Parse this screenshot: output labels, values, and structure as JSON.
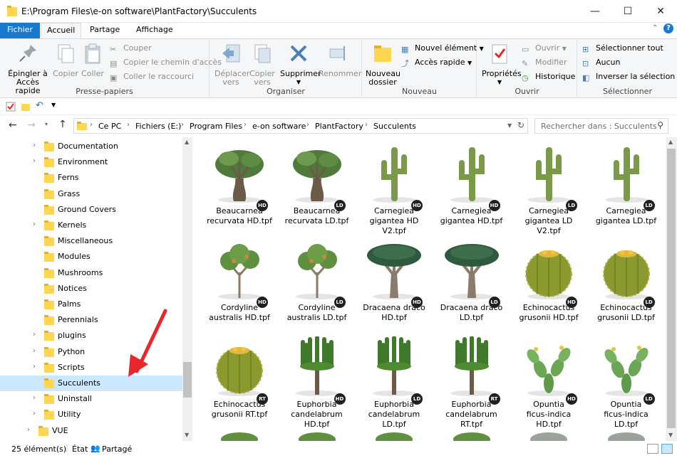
{
  "window": {
    "title": "E:\\Program Files\\e-on software\\PlantFactory\\Succulents",
    "minimize": "—",
    "maximize": "☐",
    "close": "✕"
  },
  "ribbon_tabs": [
    "Fichier",
    "Accueil",
    "Partage",
    "Affichage"
  ],
  "ribbon": {
    "clipboard": {
      "label": "Presse-papiers",
      "pin": "Épingler à\nAccès rapide",
      "pin_1": "Épingler à",
      "pin_2": "Accès rapide",
      "copy": "Copier",
      "paste": "Coller",
      "cut": "Couper",
      "copy_path": "Copier le chemin d'accès",
      "paste_shortcut": "Coller le raccourci"
    },
    "organize": {
      "label": "Organiser",
      "move_1": "Déplacer",
      "move_2": "vers",
      "copy_1": "Copier",
      "copy_2": "vers",
      "delete": "Supprimer",
      "rename": "Renommer"
    },
    "new": {
      "label": "Nouveau",
      "new_folder_1": "Nouveau",
      "new_folder_2": "dossier",
      "new_item": "Nouvel élément",
      "easy_access": "Accès rapide"
    },
    "open": {
      "label": "Ouvrir",
      "properties": "Propriétés",
      "open": "Ouvrir",
      "edit": "Modifier",
      "history": "Historique"
    },
    "select": {
      "label": "Sélectionner",
      "select_all": "Sélectionner tout",
      "none": "Aucun",
      "invert": "Inverser la sélection"
    }
  },
  "address": {
    "crumbs": [
      "Ce PC",
      "Fichiers (E:)",
      "Program Files",
      "e-on software",
      "PlantFactory",
      "Succulents"
    ],
    "search_placeholder": "Rechercher dans : Succulents"
  },
  "nav_tree": [
    {
      "label": "Documentation",
      "expandable": true
    },
    {
      "label": "Environment",
      "expandable": true
    },
    {
      "label": "Ferns",
      "expandable": false
    },
    {
      "label": "Grass",
      "expandable": false
    },
    {
      "label": "Ground Covers",
      "expandable": false
    },
    {
      "label": "Kernels",
      "expandable": true
    },
    {
      "label": "Miscellaneous",
      "expandable": false
    },
    {
      "label": "Modules",
      "expandable": false
    },
    {
      "label": "Mushrooms",
      "expandable": false
    },
    {
      "label": "Notices",
      "expandable": false
    },
    {
      "label": "Palms",
      "expandable": false
    },
    {
      "label": "Perennials",
      "expandable": false
    },
    {
      "label": "plugins",
      "expandable": true
    },
    {
      "label": "Python",
      "expandable": true
    },
    {
      "label": "Scripts",
      "expandable": true
    },
    {
      "label": "Succulents",
      "expandable": false,
      "selected": true
    },
    {
      "label": "Uninstall",
      "expandable": true
    },
    {
      "label": "Utility",
      "expandable": true
    },
    {
      "label": "VUE",
      "expandable": true
    }
  ],
  "files": [
    {
      "name": "Beaucarnea recurvata HD.tpf",
      "line1": "Beaucarnea",
      "line2": "recurvata HD.tpf",
      "line3": "",
      "badge": "HD",
      "plant": "beaucarnea"
    },
    {
      "name": "Beaucarnea recurvata LD.tpf",
      "line1": "Beaucarnea",
      "line2": "recurvata LD.tpf",
      "line3": "",
      "badge": "LD",
      "plant": "beaucarnea"
    },
    {
      "name": "Carnegiea gigantea HD V2.tpf",
      "line1": "Carnegiea",
      "line2": "gigantea HD",
      "line3": "V2.tpf",
      "badge": "HD",
      "plant": "cactus"
    },
    {
      "name": "Carnegiea gigantea HD.tpf",
      "line1": "Carnegiea",
      "line2": "gigantea HD.tpf",
      "line3": "",
      "badge": "HD",
      "plant": "cactus"
    },
    {
      "name": "Carnegiea gigantea LD V2.tpf",
      "line1": "Carnegiea",
      "line2": "gigantea LD",
      "line3": "V2.tpf",
      "badge": "LD",
      "plant": "cactus"
    },
    {
      "name": "Carnegiea gigantea LD.tpf",
      "line1": "Carnegiea",
      "line2": "gigantea LD.tpf",
      "line3": "",
      "badge": "LD",
      "plant": "cactus"
    },
    {
      "name": "Cordyline australis HD.tpf",
      "line1": "Cordyline",
      "line2": "australis HD.tpf",
      "line3": "",
      "badge": "HD",
      "plant": "cordyline"
    },
    {
      "name": "Cordyline australis LD.tpf",
      "line1": "Cordyline",
      "line2": "australis LD.tpf",
      "line3": "",
      "badge": "LD",
      "plant": "cordyline"
    },
    {
      "name": "Dracaena draco HD.tpf",
      "line1": "Dracaena draco",
      "line2": "HD.tpf",
      "line3": "",
      "badge": "HD",
      "plant": "dracaena"
    },
    {
      "name": "Dracaena draco LD.tpf",
      "line1": "Dracaena draco",
      "line2": "LD.tpf",
      "line3": "",
      "badge": "LD",
      "plant": "dracaena"
    },
    {
      "name": "Echinocactus grusonii HD.tpf",
      "line1": "Echinocactus",
      "line2": "grusonii HD.tpf",
      "line3": "",
      "badge": "HD",
      "plant": "barrel"
    },
    {
      "name": "Echinocactus grusonii LD.tpf",
      "line1": "Echinocactus",
      "line2": "grusonii LD.tpf",
      "line3": "",
      "badge": "LD",
      "plant": "barrel"
    },
    {
      "name": "Echinocactus grusonii RT.tpf",
      "line1": "Echinocactus",
      "line2": "grusonii RT.tpf",
      "line3": "",
      "badge": "RT",
      "plant": "barrel"
    },
    {
      "name": "Euphorbia candelabrum HD.tpf",
      "line1": "Euphorbia",
      "line2": "candelabrum",
      "line3": "HD.tpf",
      "badge": "HD",
      "plant": "euphorbia"
    },
    {
      "name": "Euphorbia candelabrum LD.tpf",
      "line1": "Euphorbia",
      "line2": "candelabrum",
      "line3": "LD.tpf",
      "badge": "LD",
      "plant": "euphorbia"
    },
    {
      "name": "Euphorbia candelabrum RT.tpf",
      "line1": "Euphorbia",
      "line2": "candelabrum",
      "line3": "RT.tpf",
      "badge": "RT",
      "plant": "euphorbia"
    },
    {
      "name": "Opuntia ficus-indica HD.tpf",
      "line1": "Opuntia",
      "line2": "ficus-indica",
      "line3": "HD.tpf",
      "badge": "HD",
      "plant": "opuntia"
    },
    {
      "name": "Opuntia ficus-indica LD.tpf",
      "line1": "Opuntia",
      "line2": "ficus-indica",
      "line3": "LD.tpf",
      "badge": "LD",
      "plant": "opuntia"
    }
  ],
  "status": {
    "count": "25 élément(s)",
    "state_label": "État :",
    "state_value": "Partagé"
  },
  "colors": {
    "accent": "#1979ca",
    "selection": "#cce8ff",
    "folder": "#ffd64f",
    "annotation_arrow": "#e8262b"
  }
}
